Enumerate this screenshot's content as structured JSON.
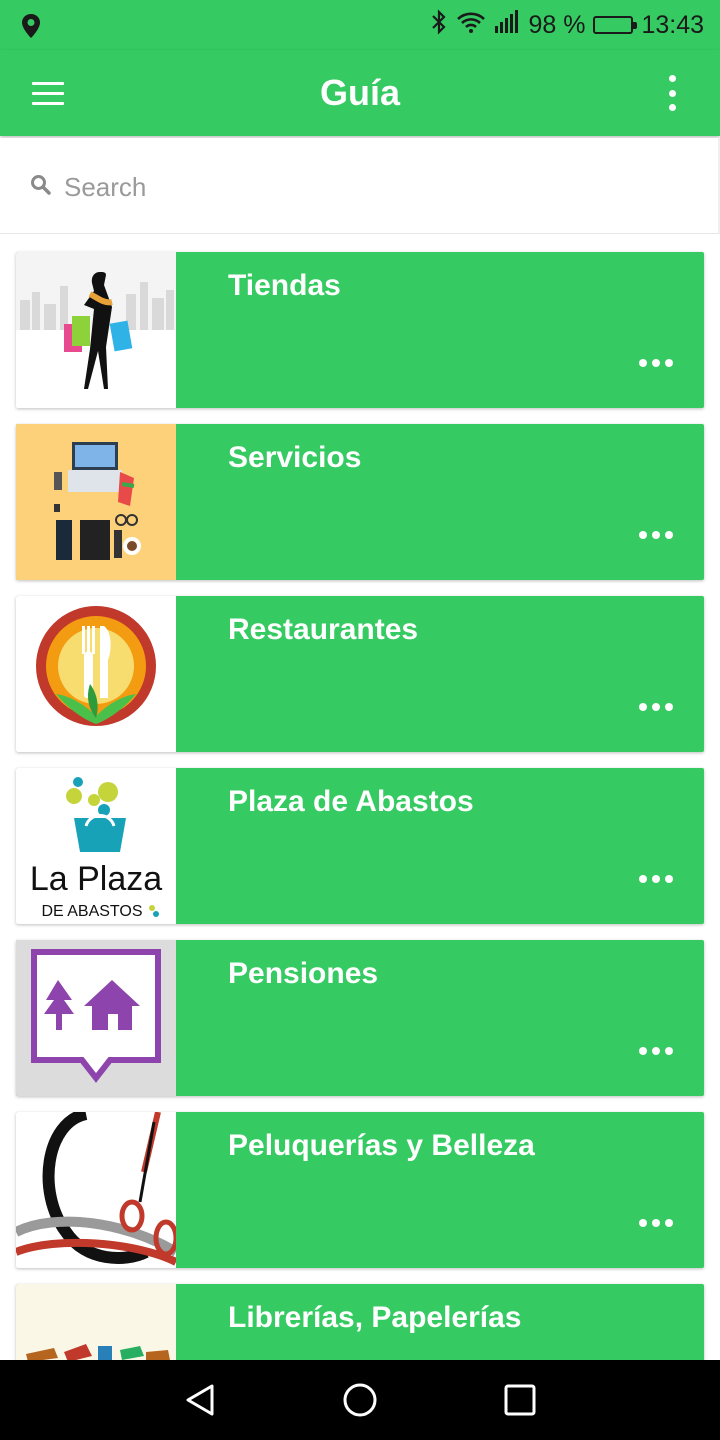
{
  "status_bar": {
    "battery_text": "98 %",
    "time": "13:43",
    "icons": [
      "location-icon",
      "bluetooth-icon",
      "wifi-icon",
      "signal-icon",
      "battery-icon"
    ]
  },
  "toolbar": {
    "title": "Guía",
    "menu_icon": "hamburger-menu-icon",
    "overflow_icon": "more-vertical-icon"
  },
  "search": {
    "placeholder": "Search",
    "icon": "search-icon"
  },
  "categories": [
    {
      "label": "Tiendas",
      "image": "shopping-woman-image"
    },
    {
      "label": "Servicios",
      "image": "office-supplies-image"
    },
    {
      "label": "Restaurantes",
      "image": "fork-knife-lotus-image"
    },
    {
      "label": "Plaza de Abastos",
      "image": "la-plaza-de-abastos-logo",
      "logo_text": [
        "La Plaza",
        "DE ABASTOS"
      ]
    },
    {
      "label": "Pensiones",
      "image": "house-tree-pin-image"
    },
    {
      "label": "Peluquerías y Belleza",
      "image": "scissors-image"
    },
    {
      "label": "Librerías, Papelerías",
      "image": "books-image"
    }
  ],
  "colors": {
    "accent": "#35cb62",
    "text_on_accent": "#ffffff",
    "placeholder": "#9a9a9a"
  },
  "nav_bar": {
    "buttons": [
      "back-icon",
      "home-icon",
      "recents-icon"
    ]
  }
}
